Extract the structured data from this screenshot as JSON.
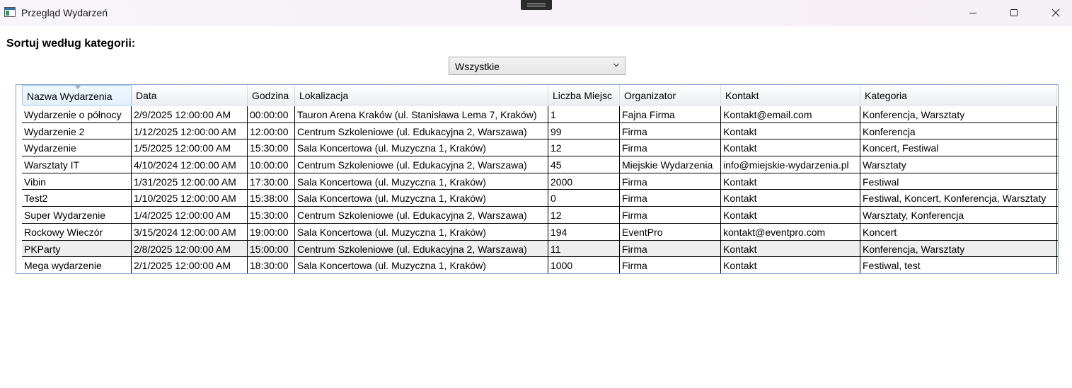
{
  "window": {
    "title": "Przegląd Wydarzeń"
  },
  "sort": {
    "label": "Sortuj według kategorii:",
    "selected": "Wszystkie"
  },
  "table": {
    "columns": [
      "Nazwa Wydarzenia",
      "Data",
      "Godzina",
      "Lokalizacja",
      "Liczba Miejsc",
      "Organizator",
      "Kontakt",
      "Kategoria"
    ],
    "rows": [
      [
        "Wydarzenie o północy",
        "2/9/2025 12:00:00 AM",
        "00:00:00",
        "Tauron Arena Kraków (ul. Stanisława Lema 7, Kraków)",
        "1",
        "Fajna Firma",
        "Kontakt@email.com",
        "Konferencja, Warsztaty"
      ],
      [
        "Wydarzenie 2",
        "1/12/2025 12:00:00 AM",
        "12:00:00",
        "Centrum Szkoleniowe (ul. Edukacyjna 2, Warszawa)",
        "99",
        "Firma",
        "Kontakt",
        "Konferencja"
      ],
      [
        "Wydarzenie",
        "1/5/2025 12:00:00 AM",
        "15:30:00",
        "Sala Koncertowa (ul. Muzyczna 1, Kraków)",
        "12",
        "Firma",
        "Kontakt",
        "Koncert, Festiwal"
      ],
      [
        "Warsztaty IT",
        "4/10/2024 12:00:00 AM",
        "10:00:00",
        "Centrum Szkoleniowe (ul. Edukacyjna 2, Warszawa)",
        "45",
        "Miejskie Wydarzenia",
        "info@miejskie-wydarzenia.pl",
        "Warsztaty"
      ],
      [
        "Vibin",
        "1/31/2025 12:00:00 AM",
        "17:30:00",
        "Sala Koncertowa (ul. Muzyczna 1, Kraków)",
        "2000",
        "Firma",
        "Kontakt",
        "Festiwal"
      ],
      [
        "Test2",
        "1/10/2025 12:00:00 AM",
        "15:38:00",
        "Sala Koncertowa (ul. Muzyczna 1, Kraków)",
        "0",
        "Firma",
        "Kontakt",
        "Festiwal, Koncert, Konferencja, Warsztaty"
      ],
      [
        "Super Wydarzenie",
        "1/4/2025 12:00:00 AM",
        "15:30:00",
        "Centrum Szkoleniowe (ul. Edukacyjna 2, Warszawa)",
        "12",
        "Firma",
        "Kontakt",
        "Warsztaty, Konferencja"
      ],
      [
        "Rockowy Wieczór",
        "3/15/2024 12:00:00 AM",
        "19:00:00",
        "Sala Koncertowa (ul. Muzyczna 1, Kraków)",
        "194",
        "EventPro",
        "kontakt@eventpro.com",
        "Koncert"
      ],
      [
        "PKParty",
        "2/8/2025 12:00:00 AM",
        "15:00:00",
        "Centrum Szkoleniowe (ul. Edukacyjna 2, Warszawa)",
        "11",
        "Firma",
        "Kontakt",
        "Konferencja, Warsztaty"
      ],
      [
        "Mega wydarzenie",
        "2/1/2025 12:00:00 AM",
        "18:30:00",
        "Sala Koncertowa (ul. Muzyczna 1, Kraków)",
        "1000",
        "Firma",
        "Kontakt",
        "Festiwal, test"
      ]
    ],
    "highlighted_row": "PKParty"
  },
  "icons": {
    "app": "app-window-icon",
    "minimize": "minimize-icon",
    "maximize": "maximize-icon",
    "close": "close-icon",
    "dropdown": "chevron-down-icon",
    "sort": "sort-indicator-icon"
  },
  "colors": {
    "grid_border": "#7aa0c8",
    "alt_row": "#eeeeee"
  }
}
